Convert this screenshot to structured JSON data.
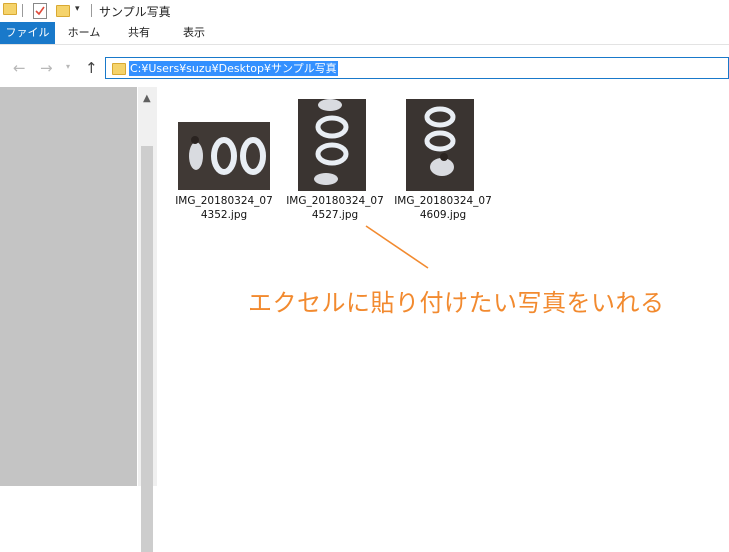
{
  "titlebar": {
    "title": "サンプル写真"
  },
  "ribbon": {
    "tabs": [
      {
        "label": "ファイル",
        "active": true
      },
      {
        "label": "ホーム"
      },
      {
        "label": "共有"
      },
      {
        "label": "表示"
      }
    ]
  },
  "address": {
    "path": "C:¥Users¥suzu¥Desktop¥サンプル写真"
  },
  "files": [
    {
      "line1": "IMG_20180324_07",
      "line2": "4352.jpg"
    },
    {
      "line1": "IMG_20180324_07",
      "line2": "4527.jpg"
    },
    {
      "line1": "IMG_20180324_07",
      "line2": "4609.jpg"
    }
  ],
  "annotation": {
    "text": "エクセルに貼り付けたい写真をいれる",
    "color": "#f28a2f"
  },
  "colors": {
    "accent": "#1979ca",
    "selection": "#3390ff",
    "nav_pane": "#c4c4c4"
  }
}
